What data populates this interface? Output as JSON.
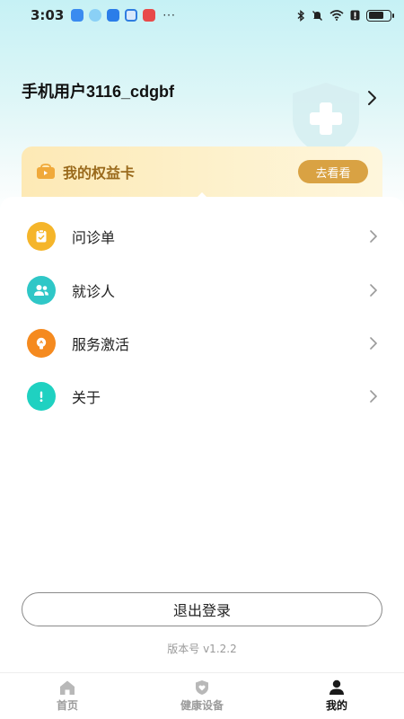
{
  "status_bar": {
    "time": "3:03",
    "more": "···"
  },
  "profile": {
    "name": "手机用户3116_cdgbf"
  },
  "rights_card": {
    "label": "我的权益卡",
    "button": "去看看"
  },
  "menu": [
    {
      "label": "问诊单",
      "icon": "consult-form-icon",
      "color": "#f5b52a"
    },
    {
      "label": "就诊人",
      "icon": "patients-icon",
      "color": "#2fc7c7"
    },
    {
      "label": "服务激活",
      "icon": "service-activation-icon",
      "color": "#f58a1f"
    },
    {
      "label": "关于",
      "icon": "info-icon",
      "color": "#1fd1c1"
    }
  ],
  "logout_label": "退出登录",
  "version": "版本号 v1.2.2",
  "tabs": [
    {
      "label": "首页",
      "icon": "home-icon"
    },
    {
      "label": "健康设备",
      "icon": "health-device-icon"
    },
    {
      "label": "我的",
      "icon": "profile-icon",
      "active": true
    }
  ],
  "colors": {
    "accent_gold": "#d9a243",
    "header_bg": "#c6f1f5"
  }
}
